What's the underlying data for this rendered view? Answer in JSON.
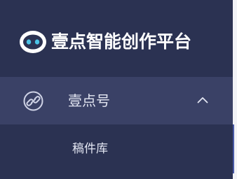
{
  "brand": {
    "title": "壹点智能创作平台",
    "logo_icon": "robot-face-icon"
  },
  "menu": {
    "parent": {
      "label": "壹点号",
      "icon": "link-circle-icon",
      "expanded": true,
      "chevron_icon": "chevron-up-icon"
    },
    "children": [
      {
        "label": "稿件库"
      }
    ]
  },
  "colors": {
    "sidebar_bg": "#2b3252",
    "active_item_bg": "#3a4166",
    "text": "#e3e6f2",
    "title": "#ffffff"
  }
}
